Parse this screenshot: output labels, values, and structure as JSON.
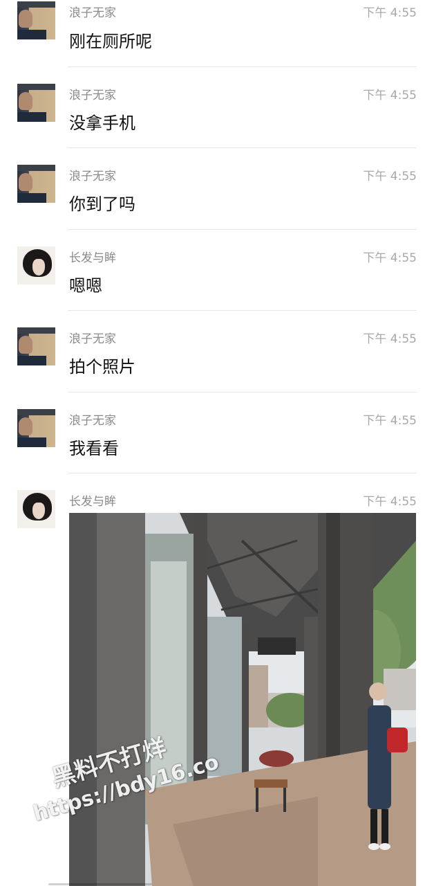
{
  "messages": [
    {
      "name": "浪子无家",
      "time": "下午 4:55",
      "text": "刚在厕所呢",
      "avatar": "male"
    },
    {
      "name": "浪子无家",
      "time": "下午 4:55",
      "text": "没拿手机",
      "avatar": "male"
    },
    {
      "name": "浪子无家",
      "time": "下午 4:55",
      "text": "你到了吗",
      "avatar": "male"
    },
    {
      "name": "长发与眸",
      "time": "下午 4:55",
      "text": "嗯嗯",
      "avatar": "female"
    },
    {
      "name": "浪子无家",
      "time": "下午 4:55",
      "text": "拍个照片",
      "avatar": "male"
    },
    {
      "name": "浪子无家",
      "time": "下午 4:55",
      "text": "我看看",
      "avatar": "male"
    },
    {
      "name": "长发与眸",
      "time": "下午 4:55",
      "text": "",
      "avatar": "female"
    }
  ],
  "watermark": {
    "line1": "黑料不打烊",
    "line2": "https://bdy16.co"
  }
}
